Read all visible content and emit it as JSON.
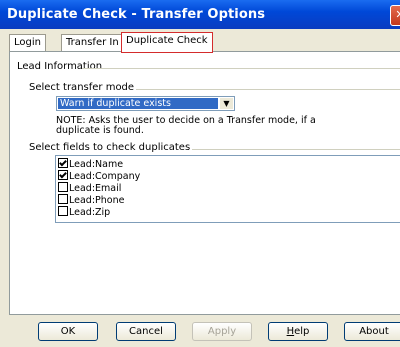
{
  "window": {
    "title": "Duplicate Check  - Transfer Options",
    "close_symbol": "✕"
  },
  "tabs": [
    {
      "label": "Login"
    },
    {
      "label": "Transfer In"
    },
    {
      "label": "Duplicate Check"
    }
  ],
  "lead_information": {
    "label": "Lead Information"
  },
  "transfer_mode": {
    "label": "Select transfer mode",
    "selected": "Warn if duplicate exists",
    "note": "NOTE: Asks the user to decide on a Transfer mode, if a duplicate is found."
  },
  "fields": {
    "label": "Select fields to check duplicates",
    "items": [
      {
        "label": "Lead:Name",
        "checked": true
      },
      {
        "label": "Lead:Company",
        "checked": true
      },
      {
        "label": "Lead:Email",
        "checked": false
      },
      {
        "label": "Lead:Phone",
        "checked": false
      },
      {
        "label": "Lead:Zip",
        "checked": false
      }
    ]
  },
  "buttons": {
    "ok": "OK",
    "cancel": "Cancel",
    "apply": "Apply",
    "help_prefix": "",
    "help_u": "H",
    "help_rest": "elp",
    "about": "About"
  }
}
